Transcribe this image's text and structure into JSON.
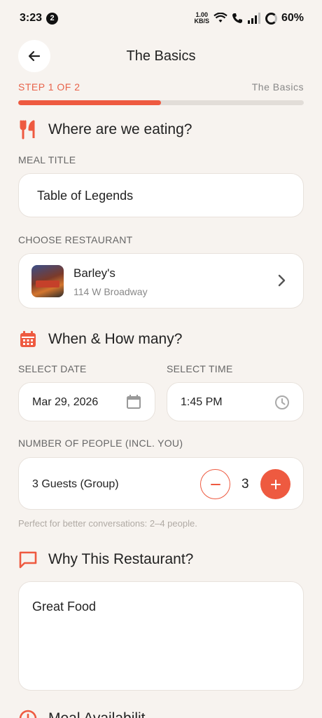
{
  "status_bar": {
    "time": "3:23",
    "notification_count": "2",
    "net_speed_value": "1.00",
    "net_speed_unit": "KB/S",
    "battery": "60%"
  },
  "header": {
    "title": "The Basics",
    "back_icon": "arrow-left-icon"
  },
  "progress": {
    "step_label": "STEP 1 OF 2",
    "step_name": "The Basics",
    "fraction": 0.5,
    "color": "#ee5a40"
  },
  "sections": {
    "eating": {
      "title": "Where are we eating?",
      "icon": "utensils-icon"
    },
    "when": {
      "title": "When & How many?",
      "icon": "calendar-icon"
    },
    "why": {
      "title": "Why This Restaurant?",
      "icon": "chat-bubble-icon"
    },
    "availability": {
      "title": "Meal Availabilit",
      "icon": "clock-icon"
    }
  },
  "meal_title": {
    "label": "MEAL TITLE",
    "value": "Table of Legends"
  },
  "restaurant": {
    "label": "CHOOSE RESTAURANT",
    "name": "Barley's",
    "address": "114 W Broadway"
  },
  "date": {
    "label": "SELECT DATE",
    "value": "Mar 29, 2026"
  },
  "time": {
    "label": "SELECT TIME",
    "value": "1:45 PM"
  },
  "people": {
    "label": "NUMBER OF PEOPLE (INCL. YOU)",
    "summary": "3 Guests (Group)",
    "count": "3",
    "hint": "Perfect for better conversations: 2–4 people."
  },
  "reason": {
    "value": "Great Food"
  },
  "colors": {
    "accent": "#ee5a40",
    "background": "#f7f3ef"
  }
}
